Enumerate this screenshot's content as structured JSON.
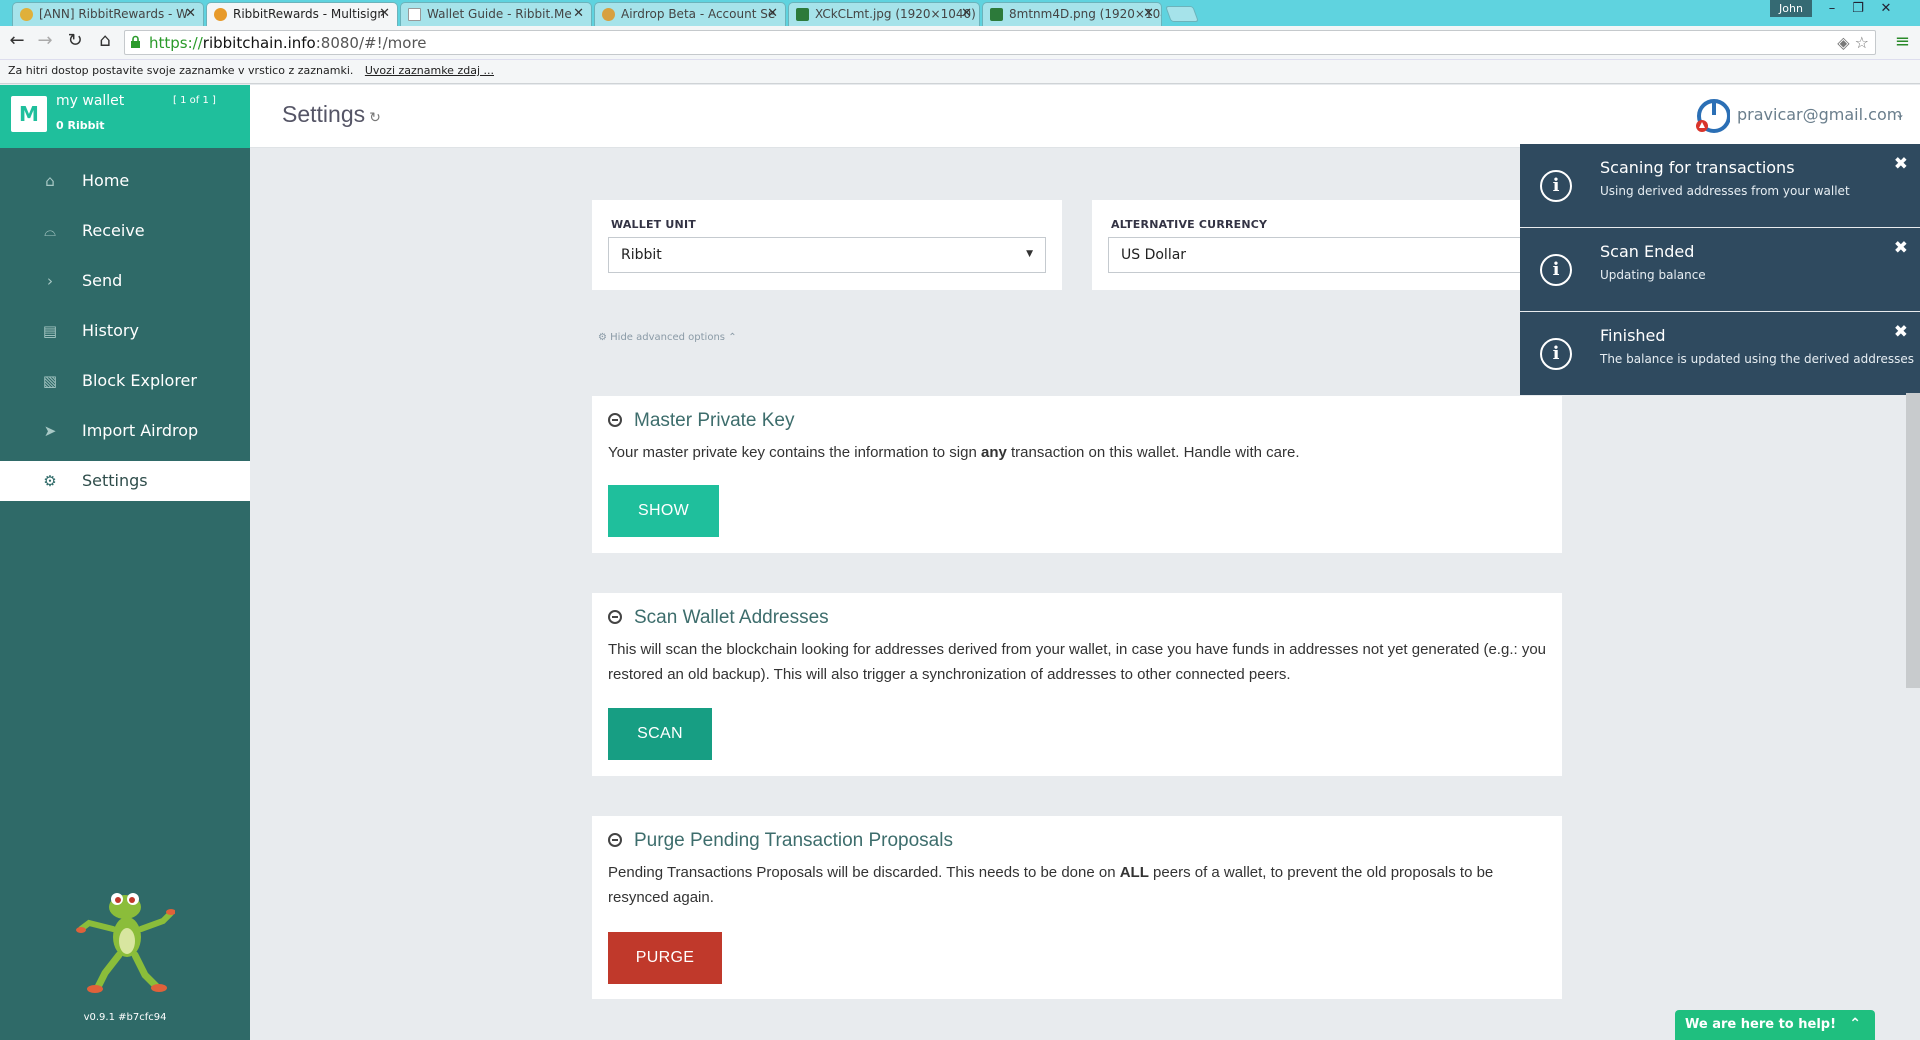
{
  "browser": {
    "tabs": [
      {
        "label": "[ANN] RibbitRewards - W",
        "favicon_color": "#e0b03a"
      },
      {
        "label": "RibbitRewards - Multisign",
        "favicon_color": "#e79a2a"
      },
      {
        "label": "Wallet Guide - Ribbit.Me",
        "favicon_color": "#ffffff"
      },
      {
        "label": "Airdrop Beta - Account Se",
        "favicon_color": "#d7a040"
      },
      {
        "label": "XCkCLmt.jpg (1920×1040)",
        "favicon_color": "#2c7a3a"
      },
      {
        "label": "8mtnm4D.png (1920×104",
        "favicon_color": "#2c7a3a"
      }
    ],
    "user": "John",
    "url_scheme": "https://",
    "url_host": "ribbitchain.info",
    "url_rest": ":8080/#!/more",
    "bookmarks_text": "Za hitri dostop postavite svoje zaznamke v vrstico z zaznamki.",
    "bookmarks_link": "Uvozi zaznamke zdaj ..."
  },
  "sidebar": {
    "avatar_letter": "M",
    "wallet_name": "my wallet",
    "wallet_index": "[ 1 of 1 ]",
    "wallet_balance": "0 Ribbit",
    "items": [
      {
        "label": "Home",
        "icon": "home-icon"
      },
      {
        "label": "Receive",
        "icon": "receive-icon"
      },
      {
        "label": "Send",
        "icon": "send-icon"
      },
      {
        "label": "History",
        "icon": "history-icon"
      },
      {
        "label": "Block Explorer",
        "icon": "chart-icon"
      },
      {
        "label": "Import Airdrop",
        "icon": "paper-plane-icon"
      },
      {
        "label": "Settings",
        "icon": "gear-icon"
      }
    ],
    "version": "v0.9.1 #b7cfc94"
  },
  "header": {
    "title": "Settings",
    "email": "pravicar@gmail.com"
  },
  "settings": {
    "wallet_unit_label": "WALLET UNIT",
    "wallet_unit_value": "Ribbit",
    "alt_currency_label": "ALTERNATIVE CURRENCY",
    "alt_currency_value": "US Dollar",
    "advanced_toggle": "Hide advanced options"
  },
  "sections": {
    "master_key": {
      "title": "Master Private Key",
      "text_before": "Your master private key contains the information to sign ",
      "text_bold": "any",
      "text_after": " transaction on this wallet. Handle with care.",
      "button": "SHOW",
      "button_color": "#1fbf9c"
    },
    "scan": {
      "title": "Scan Wallet Addresses",
      "text": "This will scan the blockchain looking for addresses derived from your wallet, in case you have funds in addresses not yet generated (e.g.: you restored an old backup). This will also trigger a synchronization of addresses to other connected peers.",
      "button": "SCAN",
      "button_color": "#179e83"
    },
    "purge": {
      "title": "Purge Pending Transaction Proposals",
      "text_before": "Pending Transactions Proposals will be discarded. This needs to be done on ",
      "text_bold": "ALL",
      "text_after": " peers of a wallet, to prevent the old proposals to be resynced again.",
      "button": "PURGE",
      "button_color": "#c0392b"
    }
  },
  "notifications": [
    {
      "title": "Scaning for transactions",
      "message": "Using derived addresses from your wallet"
    },
    {
      "title": "Scan Ended",
      "message": "Updating balance"
    },
    {
      "title": "Finished",
      "message": "The balance is updated using the derived addresses"
    }
  ],
  "help_widget": "We are here to help!"
}
